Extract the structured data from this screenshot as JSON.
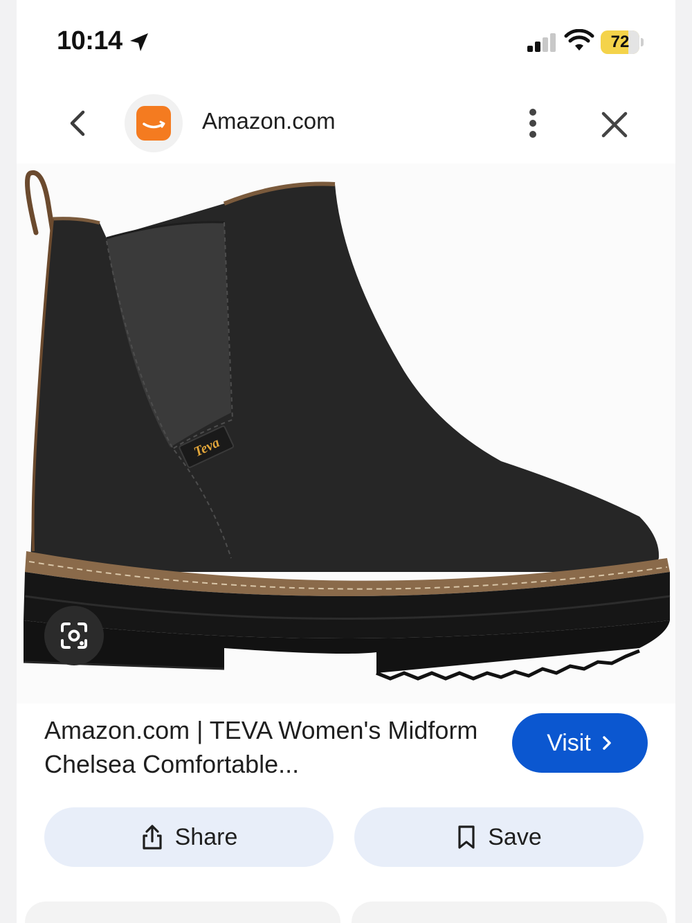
{
  "status_bar": {
    "time": "10:14",
    "battery_level": "72",
    "battery_fraction": 0.72,
    "icons": [
      "location-arrow-icon",
      "cellular-signal-icon",
      "wifi-icon",
      "battery-icon"
    ]
  },
  "header": {
    "site_name": "Amazon.com",
    "icons": [
      "back-chevron-icon",
      "amazon-favicon",
      "more-vertical-icon",
      "close-icon"
    ]
  },
  "image": {
    "brand_tag": "Teva",
    "lens_icon": "google-lens-icon"
  },
  "result": {
    "title": "Amazon.com | TEVA Women's Midform Chelsea Comfortable...",
    "visit_label": "Visit"
  },
  "actions": {
    "share_label": "Share",
    "save_label": "Save"
  },
  "colors": {
    "accent_blue": "#0b57d0",
    "action_bg": "#e8eef9",
    "amazon_orange": "#f47b20",
    "battery_yellow": "#f4d34a"
  }
}
